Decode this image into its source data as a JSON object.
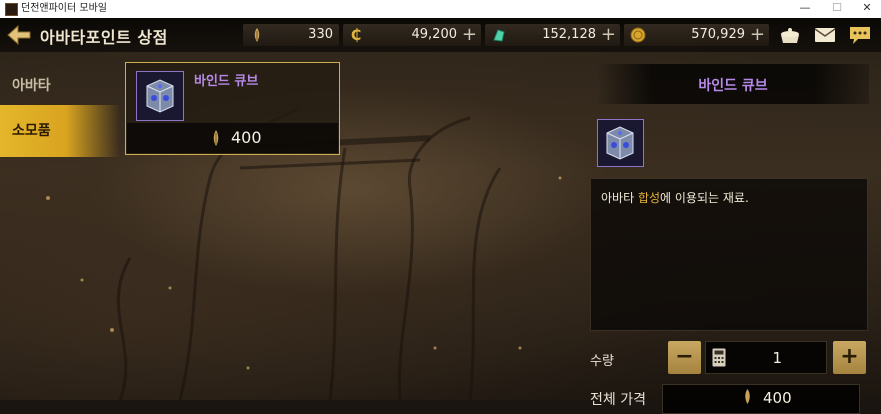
{
  "window": {
    "title": "던전앤파이터 모바일",
    "controls": [
      "—",
      "☐",
      "✕"
    ]
  },
  "header": {
    "title": "아바타포인트 상점",
    "currencies": [
      {
        "icon": "avatar-point-icon",
        "value": "330",
        "has_plus": false
      },
      {
        "icon": "gold-coin-c-icon",
        "value": "49,200",
        "has_plus": true
      },
      {
        "icon": "green-gem-icon",
        "value": "152,128",
        "has_plus": true
      },
      {
        "icon": "gold-coin-icon",
        "value": "570,929",
        "has_plus": true
      }
    ],
    "plus": "+",
    "right_icons": [
      "gift-pot-icon",
      "mail-icon",
      "chat-icon"
    ]
  },
  "tabs": [
    {
      "label": "아바타",
      "selected": false
    },
    {
      "label": "소모품",
      "selected": true
    }
  ],
  "item": {
    "name": "바인드 큐브",
    "price": "400"
  },
  "detail": {
    "title": "바인드 큐브",
    "desc_prefix": "아바타 ",
    "desc_highlight": "합성",
    "desc_suffix": "에 이용되는 재료.",
    "quantity_label": "수량",
    "quantity": "1",
    "minus": "−",
    "plus": "+",
    "total_label": "전체 가격",
    "total_price": "400"
  },
  "colors": {
    "accent_gold": "#d9a420",
    "item_name_purple": "#b68ae8",
    "highlight": "#e6b53a"
  }
}
